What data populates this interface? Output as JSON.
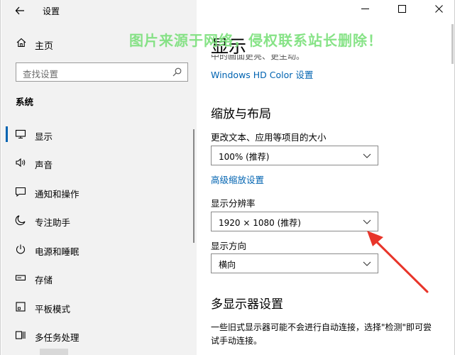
{
  "window": {
    "title": "设置",
    "controls": {
      "minimize": "—",
      "maximize": "☐",
      "close": "✕"
    }
  },
  "sidebar": {
    "home_label": "主页",
    "search_placeholder": "查找设置",
    "section": "系统",
    "items": [
      {
        "label": "显示",
        "icon": "monitor-icon",
        "active": true
      },
      {
        "label": "声音",
        "icon": "speaker-icon"
      },
      {
        "label": "通知和操作",
        "icon": "notification-icon"
      },
      {
        "label": "专注助手",
        "icon": "moon-icon"
      },
      {
        "label": "电源和睡眠",
        "icon": "power-icon"
      },
      {
        "label": "存储",
        "icon": "storage-icon"
      },
      {
        "label": "平板模式",
        "icon": "tablet-icon"
      },
      {
        "label": "多任务处理",
        "icon": "multitask-icon"
      }
    ]
  },
  "main": {
    "title": "显示",
    "watermark": "图片来源于网络，侵权联系站长删除！",
    "truncated_text": "中的画面更亮、更生动。",
    "hdr_link": "Windows HD Color 设置",
    "scale_section": "缩放与布局",
    "scale_label": "更改文本、应用等项目的大小",
    "scale_value": "100% (推荐)",
    "advanced_scale_link": "高级缩放设置",
    "resolution_label": "显示分辨率",
    "resolution_value": "1920 × 1080 (推荐)",
    "orientation_label": "显示方向",
    "orientation_value": "横向",
    "multi_section": "多显示器设置",
    "multi_desc": "一些旧式显示器可能不会进行自动连接，选择\"检测\"即可尝试手动连接。"
  },
  "colors": {
    "accent": "#0063b1",
    "annotation_arrow": "#e8352a",
    "watermark": "#7be07b"
  }
}
